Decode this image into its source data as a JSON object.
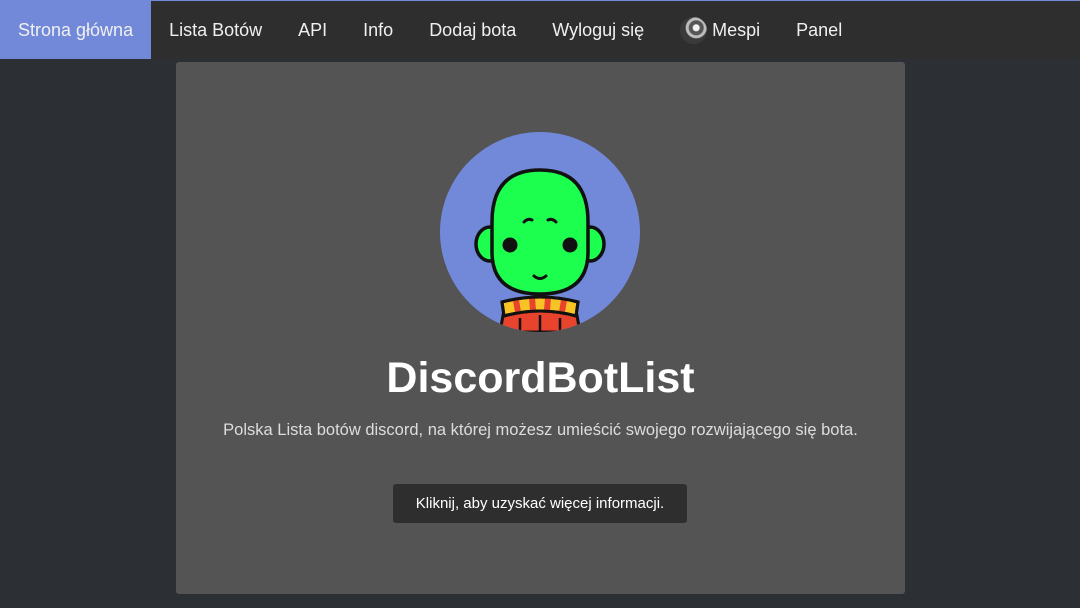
{
  "nav": {
    "items": [
      {
        "label": "Strona główna"
      },
      {
        "label": "Lista Botów"
      },
      {
        "label": "API"
      },
      {
        "label": "Info"
      },
      {
        "label": "Dodaj bota"
      },
      {
        "label": "Wyloguj się"
      },
      {
        "label": "Mespi"
      },
      {
        "label": "Panel"
      }
    ]
  },
  "hero": {
    "title": "DiscordBotList",
    "description": "Polska Lista botów discord, na której możesz umieścić swojego rozwijającego się bota.",
    "cta_label": "Kliknij, aby uzyskać więcej informacji."
  },
  "colors": {
    "accent": "#7289da",
    "page_bg": "#2c2f33",
    "navbar_bg": "#2e2e2e",
    "card_bg": "#545454",
    "mascot_face": "#1dff4f",
    "scarf_red": "#e8442d",
    "scarf_yellow": "#f7c325"
  },
  "icons": {
    "user_avatar": "user-avatar-icon",
    "logo": "green-mascot-logo"
  }
}
